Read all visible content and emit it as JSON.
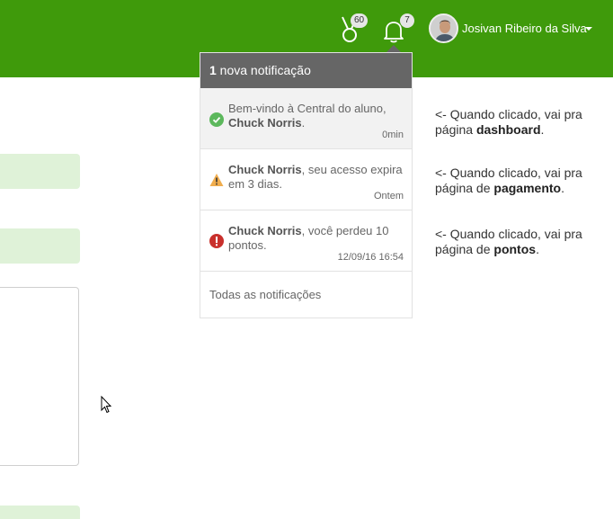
{
  "header": {
    "points_badge": "60",
    "notifications_badge": "7",
    "user_name": "Josivan Ribeiro da Silva",
    "brand_color": "#3f9a0b"
  },
  "dropdown": {
    "count": "1",
    "title": " nova notificação",
    "items": [
      {
        "bold": "",
        "pre": "Bem-vindo à Central do aluno, ",
        "name": "Chuck Norris",
        "post": ".",
        "time": "0min",
        "icon": "check-circle-icon",
        "icon_color": "#5cb85c"
      },
      {
        "pre": "",
        "name": "Chuck Norris",
        "post": ", seu acesso expira em 3 dias.",
        "time": "Ontem",
        "icon": "warning-triangle-icon",
        "icon_color": "#f0ad4e"
      },
      {
        "pre": "",
        "name": "Chuck Norris",
        "post": ", você perdeu 10 pontos.",
        "time": "12/09/16 16:54",
        "icon": "error-circle-icon",
        "icon_color": "#c9302c"
      }
    ],
    "footer_label": "Todas as notificações"
  },
  "annotations": [
    {
      "pre": "<- Quando clicado, vai pra página ",
      "bold": "dashboard",
      "post": "."
    },
    {
      "pre": "<- Quando clicado, vai pra página de ",
      "bold": "pagamento",
      "post": "."
    },
    {
      "pre": "<- Quando clicado, vai pra página de ",
      "bold": "pontos",
      "post": "."
    }
  ]
}
